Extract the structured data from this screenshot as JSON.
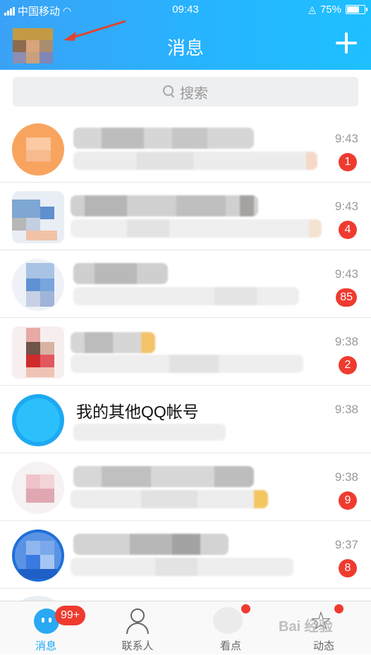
{
  "status_bar": {
    "carrier": "中国移动",
    "time": "09:43",
    "battery": "75%",
    "battery_level": 0.75
  },
  "header": {
    "title": "消息"
  },
  "search": {
    "placeholder": "搜索"
  },
  "conversations": [
    {
      "name": "",
      "time": "9:43",
      "badge": "1"
    },
    {
      "name": "",
      "time": "9:43",
      "badge": "4"
    },
    {
      "name": "",
      "time": "9:43",
      "badge": "85"
    },
    {
      "name": "",
      "time": "9:38",
      "badge": "2"
    },
    {
      "name": "我的其他QQ帐号",
      "time": "9:38",
      "badge": ""
    },
    {
      "name": "",
      "time": "9:38",
      "badge": "9"
    },
    {
      "name": "",
      "time": "9:37",
      "badge": "8"
    }
  ],
  "tabbar": {
    "tabs": [
      {
        "label": "消息",
        "badge": "99+"
      },
      {
        "label": "联系人"
      },
      {
        "label": "看点"
      },
      {
        "label": "动态"
      }
    ]
  },
  "watermark": "Bai 经验",
  "colors": {
    "header_gradient_start": "#3aa2f6",
    "header_gradient_end": "#1ec0ff",
    "badge_red": "#ef3b2f",
    "active_tab": "#1da8f5"
  }
}
